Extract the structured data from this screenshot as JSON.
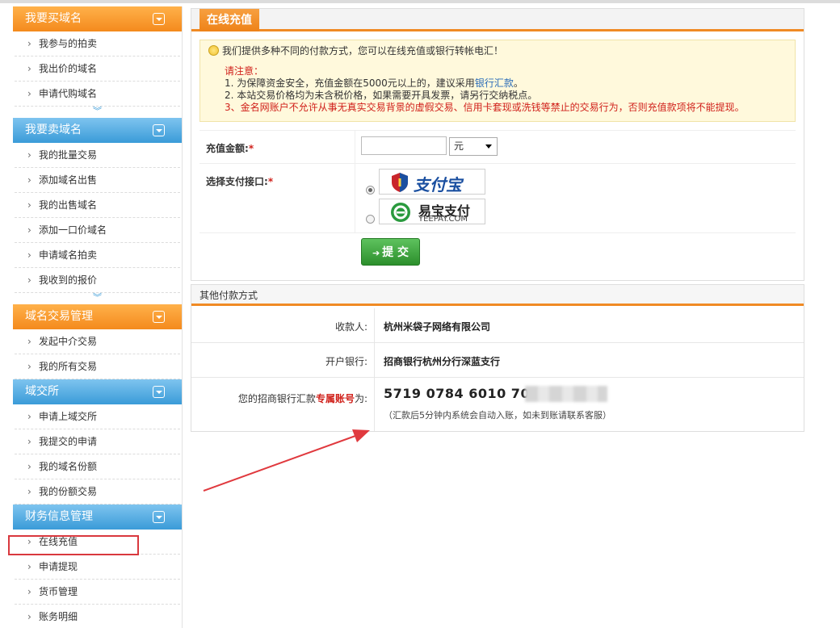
{
  "sidebar": {
    "sections": [
      {
        "title": "我要买域名",
        "color": "orange",
        "items": [
          "我参与的拍卖",
          "我出价的域名",
          "申请代购域名"
        ],
        "more": true
      },
      {
        "title": "我要卖域名",
        "color": "blue",
        "items": [
          "我的批量交易",
          "添加域名出售",
          "我的出售域名",
          "添加一口价域名",
          "申请域名拍卖",
          "我收到的报价"
        ],
        "more": true
      },
      {
        "title": "域名交易管理",
        "color": "orange",
        "items": [
          "发起中介交易",
          "我的所有交易"
        ],
        "more": false
      },
      {
        "title": "域交所",
        "color": "blue",
        "items": [
          "申请上域交所",
          "我提交的申请",
          "我的域名份额",
          "我的份额交易"
        ],
        "more": false
      },
      {
        "title": "财务信息管理",
        "color": "blue",
        "items": [
          "在线充值",
          "申请提现",
          "货币管理",
          "账务明细"
        ],
        "more": false
      }
    ],
    "active_item": "在线充值"
  },
  "recharge": {
    "tab_title": "在线充值",
    "notice": {
      "intro": "我们提供多种不同的付款方式，您可以在线充值或银行转帐电汇！",
      "caution_title": "请注意：",
      "line1_prefix": "1. 为保障资金安全，充值金额在5000元以上的，建议采用",
      "line1_link": "银行汇款",
      "line1_suffix": "。",
      "line2": "2. 本站交易价格均为未含税价格，如果需要开具发票，请另行交纳税点。",
      "line3": "3、金名网账户不允许从事无真实交易背景的虚假交易、信用卡套现或洗钱等禁止的交易行为，否则充值款项将不能提现。"
    },
    "amount_label": "充值金额:",
    "amount_value": "",
    "unit": "元",
    "gateway_label": "选择支付接口:",
    "required_mark": "*",
    "gateways": [
      {
        "name": "支付宝",
        "selected": true
      },
      {
        "name": "易宝支付",
        "sub": "YEEPAY.COM",
        "selected": false
      }
    ],
    "submit_label": "提 交"
  },
  "other": {
    "title": "其他付款方式",
    "payee_label": "收款人:",
    "payee": "杭州米袋子网络有限公司",
    "bank_label": "开户银行:",
    "bank": "招商银行杭州分行深蓝支行",
    "account_label_prefix": "您的招商银行汇款",
    "account_label_em": "专属账号",
    "account_label_suffix": "为:",
    "account": "5719 0784 6010 7060",
    "account_note": "（汇款后5分钟内系统会自动入账，如未到账请联系客服）"
  },
  "colors": {
    "accent": "#f08a24",
    "highlight": "#d9383e",
    "submit": "#2c8f2c"
  }
}
